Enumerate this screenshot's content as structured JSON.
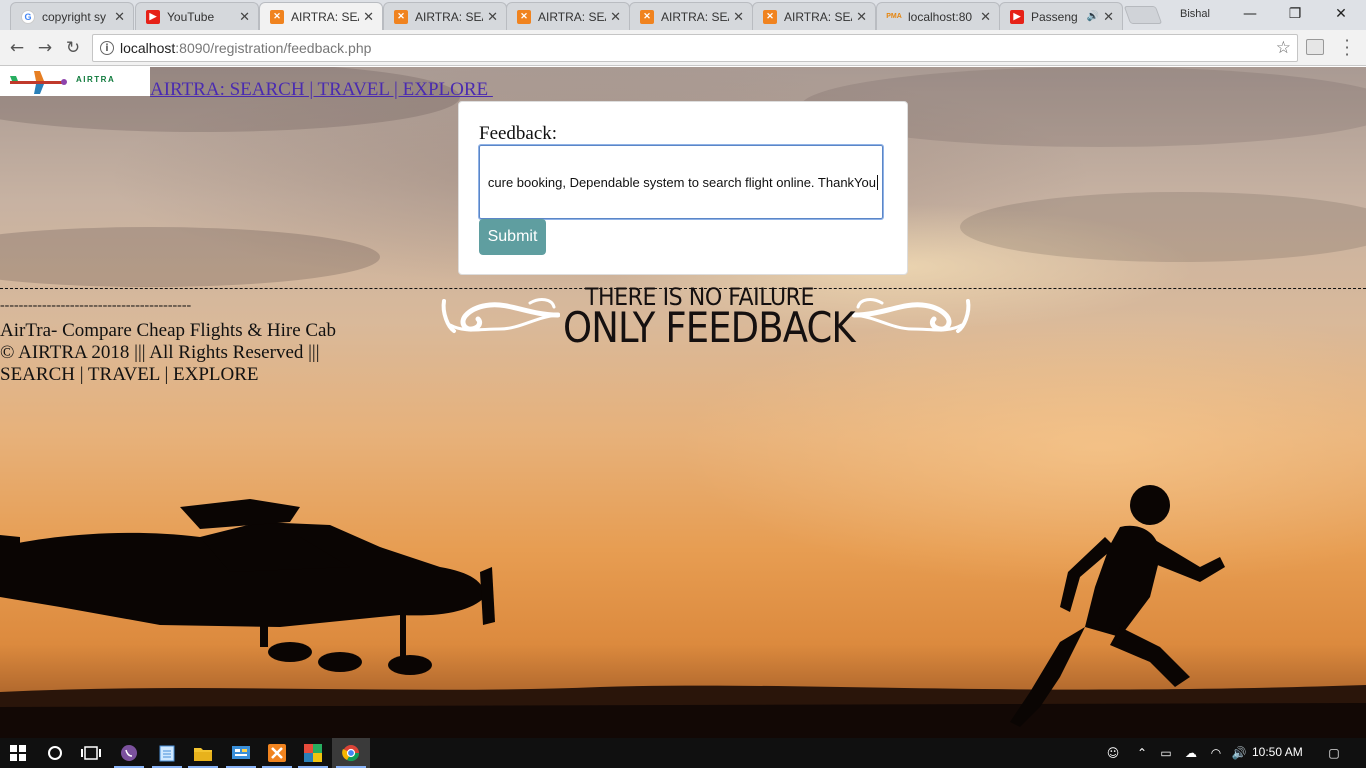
{
  "browser": {
    "tabs": [
      {
        "title": "copyright sy",
        "favicon": "google-icon"
      },
      {
        "title": "YouTube",
        "favicon": "youtube-icon"
      },
      {
        "title": "AIRTRA: SEA",
        "favicon": "xampp-icon"
      },
      {
        "title": "AIRTRA: SEA",
        "favicon": "xampp-icon"
      },
      {
        "title": "AIRTRA: SEA",
        "favicon": "xampp-icon"
      },
      {
        "title": "AIRTRA: SEA",
        "favicon": "xampp-icon"
      },
      {
        "title": "AIRTRA: SEA",
        "favicon": "xampp-icon"
      },
      {
        "title": "localhost:80",
        "favicon": "phpmyadmin-icon"
      },
      {
        "title": "Passeng",
        "favicon": "youtube-icon"
      }
    ],
    "profile_name": "Bishal",
    "url_host": "localhost",
    "url_path": ":8090/registration/feedback.php"
  },
  "page": {
    "logo_text": "AIRTRA",
    "site_link": "AIRTRA: SEARCH | TRAVEL | EXPLORE ",
    "feedback_label": "Feedback:",
    "feedback_value": "cure booking, Dependable system to search flight online. ThankYou",
    "submit_label": "Submit",
    "dash_row": "-----------------------------------------",
    "footer": {
      "line1": "AirTra- Compare Cheap Flights & Hire Cab",
      "line2": "© AIRTRA 2018 ||| All Rights Reserved |||",
      "line3": "SEARCH | TRAVEL | EXPLORE"
    },
    "quote": {
      "top": "THERE IS NO FAILURE",
      "main": "ONLY FEEDBACK"
    },
    "colors": {
      "submit_bg": "#5f9ea0",
      "link": "#4a2bb0"
    }
  },
  "taskbar": {
    "clock": "10:50 AM"
  }
}
